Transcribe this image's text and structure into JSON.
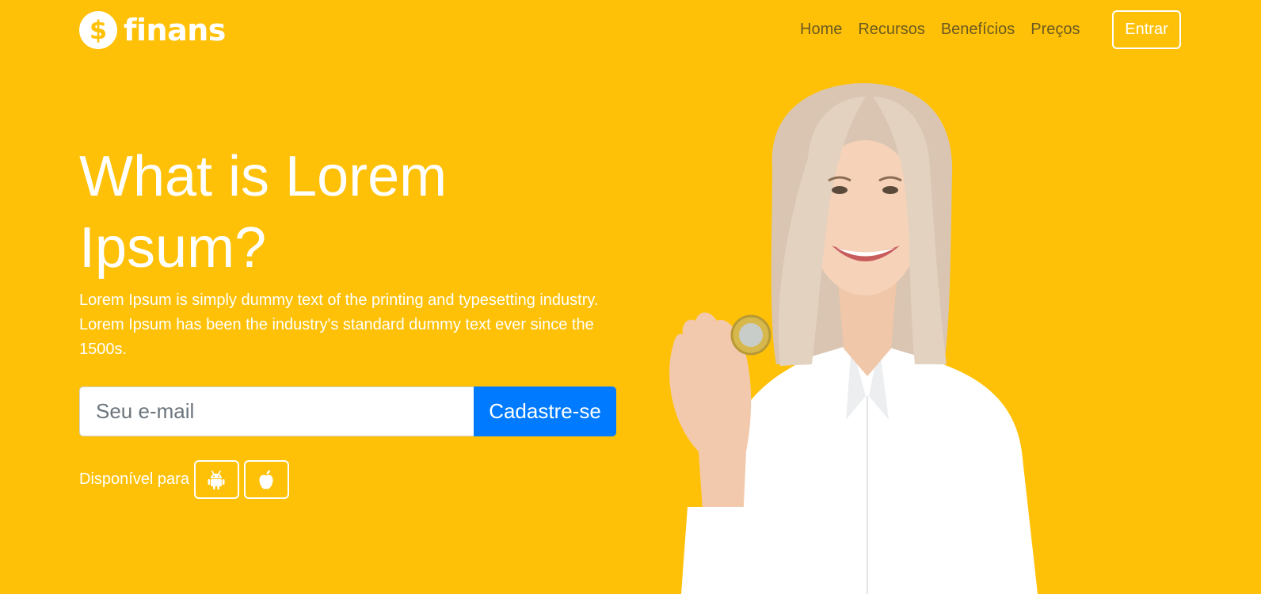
{
  "brand": {
    "logo_symbol": "$",
    "name": "finans",
    "color": "#FFC107"
  },
  "nav": {
    "links": [
      {
        "label": "Home"
      },
      {
        "label": "Recursos"
      },
      {
        "label": "Benefícios"
      },
      {
        "label": "Preços"
      }
    ],
    "login_label": "Entrar"
  },
  "hero": {
    "title": "What is Lorem Ipsum?",
    "description": "Lorem Ipsum is simply dummy text of the printing and typesetting industry. Lorem Ipsum has been the industry's standard dummy text ever since the 1500s.",
    "email_placeholder": "Seu e-mail",
    "email_value": "",
    "signup_label": "Cadastre-se",
    "available_label": "Disponível para",
    "stores": [
      {
        "icon": "android-icon"
      },
      {
        "icon": "apple-icon"
      }
    ]
  },
  "colors": {
    "background": "#FFC107",
    "primary": "#007bff",
    "white": "#ffffff",
    "nav_text": "#6b5a22"
  }
}
